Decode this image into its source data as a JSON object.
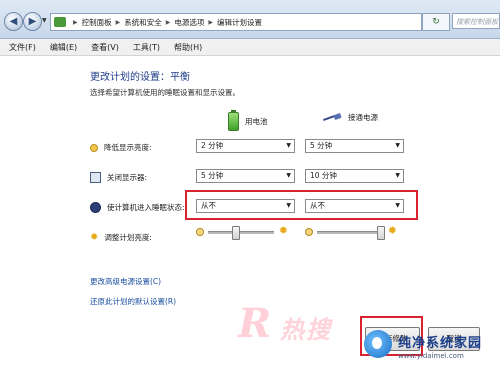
{
  "address_bar": {
    "breadcrumb": [
      "控制面板",
      "系统和安全",
      "电源选项",
      "编辑计划设置"
    ],
    "search_placeholder": "搜索控制面板"
  },
  "menu": [
    "文件(F)",
    "编辑(E)",
    "查看(V)",
    "工具(T)",
    "帮助(H)"
  ],
  "page": {
    "title": "更改计划的设置：平衡",
    "subtitle": "选择希望计算机使用的睡眠设置和显示设置。"
  },
  "columns": {
    "battery": "用电池",
    "plugged_in": "接通电源"
  },
  "settings": [
    {
      "label": "降低显示亮度:",
      "battery": "2 分钟",
      "plugged_in": "5 分钟",
      "icon": "dim-icon"
    },
    {
      "label": "关闭显示器:",
      "battery": "5 分钟",
      "plugged_in": "10 分钟",
      "icon": "monitor-icon"
    },
    {
      "label": "使计算机进入睡眠状态:",
      "battery": "从不",
      "plugged_in": "从不",
      "icon": "moon-icon"
    }
  ],
  "brightness": {
    "label": "调整计划亮度:",
    "battery_level": 0.4,
    "plugged_level": 1.0
  },
  "links": {
    "advanced": "更改高级电源设置(C)",
    "restore": "还原此计划的默认设置(R)"
  },
  "buttons": {
    "save": "保存修改",
    "cancel": "取消"
  },
  "watermark": {
    "logo_text": "纯净系统家园",
    "logo_url": "www.yidaimei.com"
  },
  "colors": {
    "accent_title": "#1f3c8a",
    "highlight": "#d9232e",
    "link": "#1a4fa0"
  }
}
